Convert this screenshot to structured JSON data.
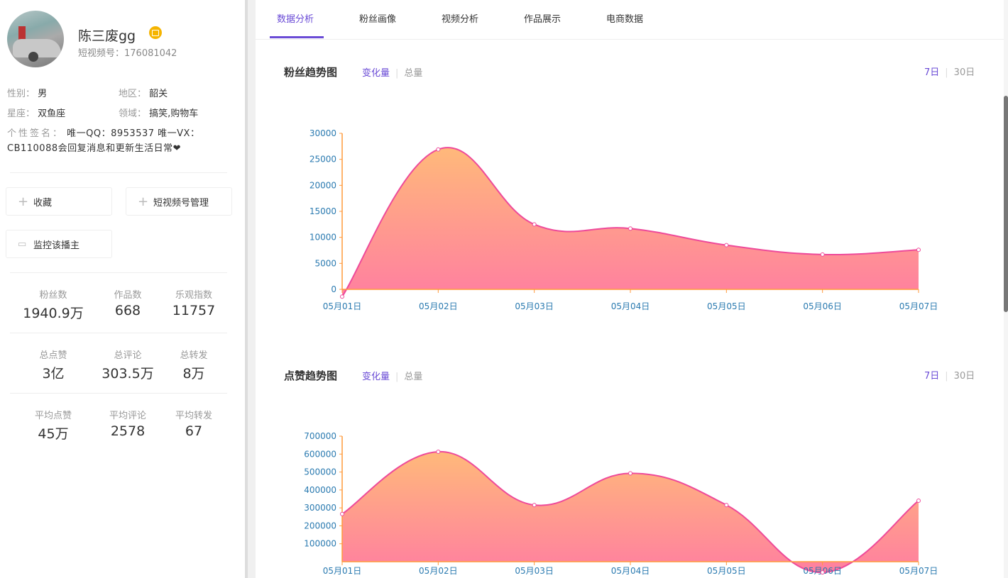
{
  "profile": {
    "name": "陈三废gg",
    "uid_label": "短视频号：",
    "uid": "176081042",
    "gender_label": "性别：",
    "gender": "男",
    "region_label": "地区：",
    "region": "韶关",
    "zodiac_label": "星座：",
    "zodiac": "双鱼座",
    "field_label": "领域：",
    "field": "搞笑,购物车",
    "signature_label": "个性签名：",
    "signature": "唯一QQ：8953537 唯一VX：CB110088会回复消息和更新生活日常❤"
  },
  "buttons": {
    "favorite": "收藏",
    "manage": "短视频号管理",
    "monitor": "监控该播主"
  },
  "stats": [
    {
      "label": "粉丝数",
      "value": "1940.9万"
    },
    {
      "label": "作品数",
      "value": "668"
    },
    {
      "label": "乐观指数",
      "value": "11757"
    },
    {
      "label": "总点赞",
      "value": "3亿"
    },
    {
      "label": "总评论",
      "value": "303.5万"
    },
    {
      "label": "总转发",
      "value": "8万"
    },
    {
      "label": "平均点赞",
      "value": "45万"
    },
    {
      "label": "平均评论",
      "value": "2578"
    },
    {
      "label": "平均转发",
      "value": "67"
    }
  ],
  "tabs": [
    {
      "label": "数据分析",
      "active": true
    },
    {
      "label": "粉丝画像"
    },
    {
      "label": "视频分析"
    },
    {
      "label": "作品展示"
    },
    {
      "label": "电商数据"
    }
  ],
  "toggles": {
    "change": "变化量",
    "total": "总量",
    "d7": "7日",
    "d30": "30日"
  },
  "colors": {
    "accent": "#6a4bd6",
    "line": "#ee4a9a",
    "fill_top": "#ffb97a",
    "fill_bottom": "#ff7fa0",
    "axis": "#ff9a3c",
    "tick": "#2a7ab0"
  },
  "chart_data": [
    {
      "type": "area",
      "title": "粉丝趋势图",
      "categories": [
        "05月01日",
        "05月02日",
        "05月03日",
        "05月04日",
        "05月05日",
        "05月06日",
        "05月07日"
      ],
      "values": [
        -1400,
        26900,
        12500,
        11700,
        8500,
        6700,
        7600
      ],
      "ylim": [
        0,
        30000
      ],
      "yticks": [
        0,
        5000,
        10000,
        15000,
        20000,
        25000,
        30000
      ],
      "smooth": true,
      "grid": false
    },
    {
      "type": "area",
      "title": "点赞趋势图",
      "categories": [
        "05月01日",
        "05月02日",
        "05月03日",
        "05月04日",
        "05月05日",
        "05月06日",
        "05月07日"
      ],
      "values": [
        266000,
        613000,
        316000,
        493000,
        316000,
        -60000,
        340000
      ],
      "ylim": [
        0,
        700000
      ],
      "yticks": [
        100000,
        200000,
        300000,
        400000,
        500000,
        600000,
        700000
      ],
      "smooth": true,
      "grid": false
    }
  ]
}
